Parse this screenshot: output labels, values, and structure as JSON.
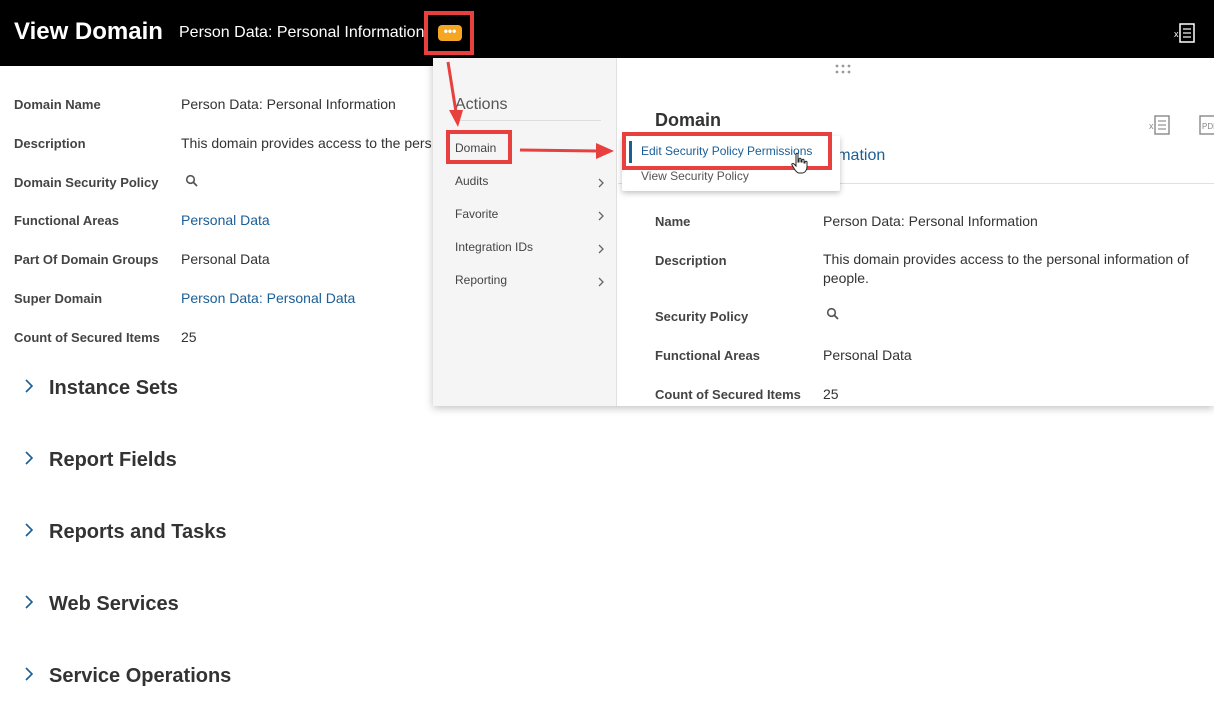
{
  "header": {
    "title": "View Domain",
    "subtitle": "Person Data: Personal Information",
    "related_actions_icon": "ellipsis-icon",
    "export_icon": "excel-export-icon"
  },
  "details": {
    "fields": [
      {
        "label": "Domain Name",
        "value": "Person Data: Personal Information"
      },
      {
        "label": "Description",
        "value": "This domain provides access to the pers"
      },
      {
        "label": "Domain Security Policy",
        "value": ""
      },
      {
        "label": "Functional Areas",
        "value": "Personal Data"
      },
      {
        "label": "Part Of Domain Groups",
        "value": "Personal Data"
      },
      {
        "label": "Super Domain",
        "value": "Person Data: Personal Data"
      },
      {
        "label": "Count of Secured Items",
        "value": "25"
      }
    ]
  },
  "sections": [
    {
      "label": "Instance Sets"
    },
    {
      "label": "Report Fields"
    },
    {
      "label": "Reports and Tasks"
    },
    {
      "label": "Web Services"
    },
    {
      "label": "Service Operations"
    }
  ],
  "popup": {
    "actions_title": "Actions",
    "actions": [
      {
        "label": "Domain"
      },
      {
        "label": "Audits"
      },
      {
        "label": "Favorite"
      },
      {
        "label": "Integration IDs"
      },
      {
        "label": "Reporting"
      }
    ],
    "detail_title": "Domain",
    "detail_subtitle": "ormation",
    "detail_fields": [
      {
        "label": "Name",
        "value": "Person Data: Personal Information"
      },
      {
        "label": "Description",
        "value": "This domain provides access to the personal information of people."
      },
      {
        "label": "Security Policy",
        "value": ""
      },
      {
        "label": "Functional Areas",
        "value": "Personal Data"
      },
      {
        "label": "Count of Secured Items",
        "value": "25"
      }
    ],
    "submenu": [
      {
        "label": "Edit Security Policy Permissions"
      },
      {
        "label": "View Security Policy"
      }
    ],
    "pdf_label": "PDF"
  },
  "colors": {
    "header_bg": "#000000",
    "link": "#1a5e96",
    "related_actions": "#f5a623",
    "annotation": "#e8403e"
  }
}
